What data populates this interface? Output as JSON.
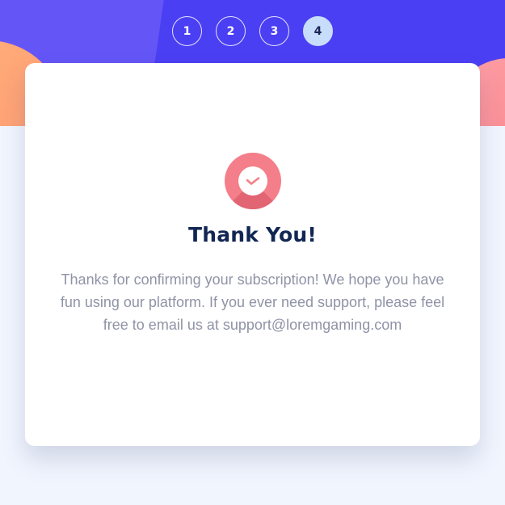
{
  "colors": {
    "hero_bg": "#4b3ff3",
    "accent_pink": "#f47e89",
    "title_color": "#122653",
    "text_muted": "#8f93a6",
    "active_step_bg": "#c8ddfb"
  },
  "steps": [
    {
      "label": "1",
      "active": false
    },
    {
      "label": "2",
      "active": false
    },
    {
      "label": "3",
      "active": false
    },
    {
      "label": "4",
      "active": true
    }
  ],
  "card": {
    "icon": "check-circle-icon",
    "title": "Thank You!",
    "message": "Thanks for confirming your subscription! We hope you have fun using our platform. If you ever need support, please feel free to email us at support@loremgaming.com"
  }
}
